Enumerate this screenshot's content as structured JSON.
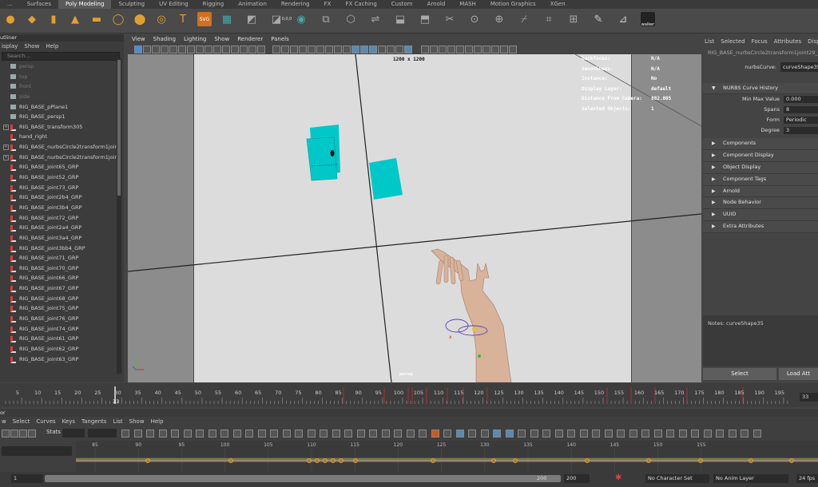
{
  "shelf_tabs": [
    "...",
    "Surfaces",
    "Poly Modeling",
    "Sculpting",
    "UV Editing",
    "Rigging",
    "Animation",
    "Rendering",
    "FX",
    "FX Caching",
    "Custom",
    "Arnold",
    "MASH",
    "Motion Graphics",
    "XGen"
  ],
  "active_shelf_tab": "Poly Modeling",
  "shelf_icons": [
    "sphere-icon",
    "cube-icon",
    "cylinder-icon",
    "cone-icon",
    "plane-icon",
    "torus-icon",
    "disc-icon",
    "pipe-icon",
    "text-icon",
    "svg-icon",
    "grid-icon",
    "combine-icon",
    "separate-icon",
    "smooth-icon",
    "mirror-icon",
    "bevel-icon",
    "bridge-icon",
    "extrude-icon",
    "append-icon",
    "multicut-icon",
    "target-weld-icon",
    "connect-icon",
    "knife-icon",
    "quad-draw-icon",
    "unfold-icon",
    "pencil-icon",
    "measure-icon",
    "walker-icon"
  ],
  "shelf_icon_caption": "walker",
  "svg_icon_text": "SVG",
  "counter_icon_text": "0,0,0",
  "outliner": {
    "title": "utliner",
    "menu": [
      "isplay",
      "Show",
      "Help"
    ],
    "search_placeholder": "Search...",
    "items": [
      {
        "label": "persp",
        "dim": true,
        "type": "camera",
        "expand": false
      },
      {
        "label": "top",
        "dim": true,
        "type": "camera",
        "expand": false
      },
      {
        "label": "front",
        "dim": true,
        "type": "camera",
        "expand": false
      },
      {
        "label": "side",
        "dim": true,
        "type": "camera",
        "expand": false
      },
      {
        "label": "RIG_BASE_pPlane1",
        "dim": false,
        "type": "camera",
        "expand": false
      },
      {
        "label": "RIG_BASE_persp1",
        "dim": false,
        "type": "camera",
        "expand": false
      },
      {
        "label": "RIG_BASE_transform305",
        "dim": false,
        "type": "joint",
        "expand": true
      },
      {
        "label": "hand_right",
        "dim": false,
        "type": "joint",
        "expand": false
      },
      {
        "label": "RIG_BASE_nurbsCircle2transform1joir",
        "dim": false,
        "type": "joint",
        "expand": true
      },
      {
        "label": "RIG_BASE_nurbsCircle2transform1joir",
        "dim": false,
        "type": "joint",
        "expand": true
      },
      {
        "label": "RIG_BASE_joint65_GRP",
        "dim": false,
        "type": "joint",
        "expand": false
      },
      {
        "label": "RIG_BASE_joint52_GRP",
        "dim": false,
        "type": "joint",
        "expand": false
      },
      {
        "label": "RIG_BASE_joint73_GRP",
        "dim": false,
        "type": "joint",
        "expand": false
      },
      {
        "label": "RIG_BASE_joint2b4_GRP",
        "dim": false,
        "type": "joint",
        "expand": false
      },
      {
        "label": "RIG_BASE_joint3b4_GRP",
        "dim": false,
        "type": "joint",
        "expand": false
      },
      {
        "label": "RIG_BASE_joint72_GRP",
        "dim": false,
        "type": "joint",
        "expand": false
      },
      {
        "label": "RIG_BASE_joint2a4_GRP",
        "dim": false,
        "type": "joint",
        "expand": false
      },
      {
        "label": "RIG_BASE_joint3a4_GRP",
        "dim": false,
        "type": "joint",
        "expand": false
      },
      {
        "label": "RIG_BASE_joint3bb4_GRP",
        "dim": false,
        "type": "joint",
        "expand": false
      },
      {
        "label": "RIG_BASE_joint71_GRP",
        "dim": false,
        "type": "joint",
        "expand": false
      },
      {
        "label": "RIG_BASE_joint70_GRP",
        "dim": false,
        "type": "joint",
        "expand": false
      },
      {
        "label": "RIG_BASE_joint66_GRP",
        "dim": false,
        "type": "joint",
        "expand": false
      },
      {
        "label": "RIG_BASE_joint67_GRP",
        "dim": false,
        "type": "joint",
        "expand": false
      },
      {
        "label": "RIG_BASE_joint68_GRP",
        "dim": false,
        "type": "joint",
        "expand": false
      },
      {
        "label": "RIG_BASE_joint75_GRP",
        "dim": false,
        "type": "joint",
        "expand": false
      },
      {
        "label": "RIG_BASE_joint76_GRP",
        "dim": false,
        "type": "joint",
        "expand": false
      },
      {
        "label": "RIG_BASE_joint74_GRP",
        "dim": false,
        "type": "joint",
        "expand": false
      },
      {
        "label": "RIG_BASE_joint61_GRP",
        "dim": false,
        "type": "joint",
        "expand": false
      },
      {
        "label": "RIG_BASE_joint62_GRP",
        "dim": false,
        "type": "joint",
        "expand": false
      },
      {
        "label": "RIG_BASE_joint63_GRP",
        "dim": false,
        "type": "joint",
        "expand": false
      }
    ]
  },
  "viewport": {
    "menu": [
      "View",
      "Shading",
      "Lighting",
      "Show",
      "Renderer",
      "Panels"
    ],
    "resolution": "1200 x 1200",
    "camera_label": "persp",
    "hud": [
      {
        "label": "Backfaces:",
        "value": "N/A"
      },
      {
        "label": "Smoothness:",
        "value": "N/A"
      },
      {
        "label": "Instance:",
        "value": "No"
      },
      {
        "label": "Display Layer:",
        "value": "default"
      },
      {
        "label": "Distance From Camera:",
        "value": "882.805"
      },
      {
        "label": "Selected Objects:",
        "value": "1"
      }
    ],
    "colors": {
      "gate": "#dcdcdc",
      "outside": "#8c8c8c",
      "mesh": "#00c8c8",
      "skin": "#d9b29a"
    }
  },
  "attribute_editor": {
    "menu": [
      "List",
      "Selected",
      "Focus",
      "Attributes",
      "Disp"
    ],
    "node_tab": "RIG_BASE_nurbsCircle2transform1joint29_",
    "node_label": "nurbsCurve:",
    "node_value": "curveShape35",
    "open_section": "NURBS Curve History",
    "attrs": [
      {
        "label": "Min Max Value",
        "value": "0.000"
      },
      {
        "label": "Spans",
        "value": "8"
      },
      {
        "label": "Form",
        "value": "Periodic"
      },
      {
        "label": "Degree",
        "value": "3"
      }
    ],
    "sections": [
      "Components",
      "Component Display",
      "Object Display",
      "Component Tags",
      "Arnold",
      "Node Behavior",
      "UUID",
      "Extra Attributes"
    ],
    "notes": "Notes: curveShape35",
    "select_label": "Select",
    "load_label": "Load Att"
  },
  "timeslider": {
    "ticks": [
      "5",
      "10",
      "15",
      "20",
      "25",
      "30",
      "35",
      "40",
      "45",
      "50",
      "55",
      "60",
      "65",
      "70",
      "75",
      "80",
      "85",
      "90",
      "95",
      "100",
      "105",
      "110",
      "115",
      "120",
      "125",
      "130",
      "135",
      "140",
      "145",
      "150",
      "155",
      "160",
      "165",
      "170",
      "175",
      "180",
      "185",
      "190",
      "195"
    ],
    "current_frame": "33",
    "current_frame_field": "33"
  },
  "graph_editor": {
    "title": "or",
    "menu": [
      "w",
      "Select",
      "Curves",
      "Keys",
      "Tangents",
      "List",
      "Show",
      "Help"
    ],
    "stats_label": "Stats",
    "ruler": [
      "85",
      "90",
      "95",
      "100",
      "105",
      "110",
      "115",
      "120",
      "125",
      "130",
      "135",
      "140",
      "145",
      "150",
      "155"
    ]
  },
  "range_bar": {
    "start": "1",
    "end": "200",
    "end2": "200",
    "character_set": "No Character Set",
    "anim_layer": "No Anim Layer",
    "fps": "24 fps"
  }
}
